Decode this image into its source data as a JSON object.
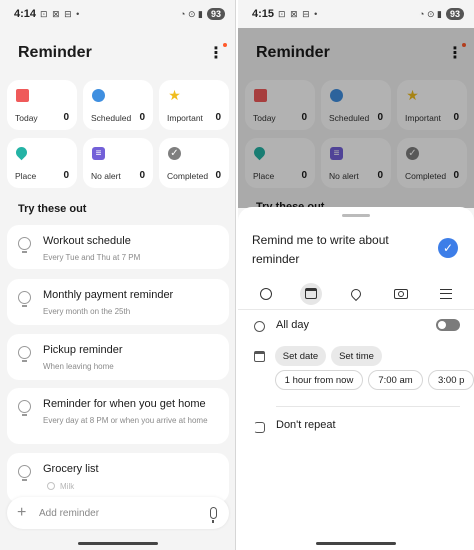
{
  "left": {
    "status": {
      "time": "4:14",
      "icons": "⊡ ⊠ ⊟ •",
      "sys": "◔ ⊙ ▮",
      "battery": "93"
    },
    "app_title": "Reminder",
    "tiles": [
      {
        "label": "Today",
        "count": "0",
        "icon": "calendar-icon"
      },
      {
        "label": "Scheduled",
        "count": "0",
        "icon": "clock-icon"
      },
      {
        "label": "Important",
        "count": "0",
        "icon": "star-icon"
      },
      {
        "label": "Place",
        "count": "0",
        "icon": "location-pin-icon"
      },
      {
        "label": "No alert",
        "count": "0",
        "icon": "list-icon"
      },
      {
        "label": "Completed",
        "count": "0",
        "icon": "check-icon"
      }
    ],
    "section_title": "Try these out",
    "suggestions": [
      {
        "title": "Workout schedule",
        "subtitle": "Every Tue and Thu at 7 PM"
      },
      {
        "title": "Monthly payment reminder",
        "subtitle": "Every month on the 25th"
      },
      {
        "title": "Pickup reminder",
        "subtitle": "When leaving home"
      },
      {
        "title": "Reminder for when you get home",
        "subtitle": "Every day at 8 PM or when you arrive at home"
      },
      {
        "title": "Grocery list",
        "subtitle": "Milk"
      }
    ],
    "add_placeholder": "Add reminder"
  },
  "right": {
    "status": {
      "time": "4:15",
      "icons": "⊡ ⊠ ⊟ •",
      "sys": "◔ ⊙ ▮",
      "battery": "93"
    },
    "app_title": "Reminder",
    "tiles": [
      {
        "label": "Today",
        "count": "0"
      },
      {
        "label": "Scheduled",
        "count": "0"
      },
      {
        "label": "Important",
        "count": "0"
      },
      {
        "label": "Place",
        "count": "0"
      },
      {
        "label": "No alert",
        "count": "0"
      },
      {
        "label": "Completed",
        "count": "0"
      }
    ],
    "section_title_partial": "Try these out",
    "sheet": {
      "reminder_text": "Remind me to write about reminder",
      "all_day_label": "All day",
      "set_date": "Set date",
      "set_time": "Set time",
      "quick_options": [
        "1 hour from now",
        "7:00 am",
        "3:00 p"
      ],
      "repeat_label": "Don't repeat"
    }
  },
  "colors": {
    "accent_blue": "#3d7ee8",
    "today_red": "#ef5a5a",
    "scheduled_blue": "#3f8fe0",
    "important_yellow": "#f0bd1e",
    "place_teal": "#24b3a5",
    "noalert_purple": "#7360d8",
    "completed_gray": "#7f7f7f"
  }
}
